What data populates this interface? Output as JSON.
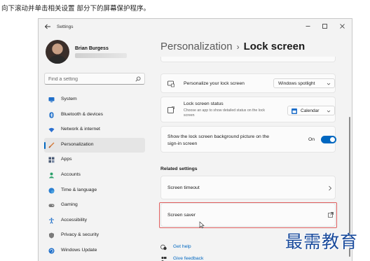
{
  "instruction": "向下滚动并单击相关设置 部分下的屏幕保护程序。",
  "window": {
    "title": "Settings",
    "controls": {
      "minimize": "minimize-icon",
      "maximize": "maximize-icon",
      "close": "close-icon"
    }
  },
  "profile": {
    "name": "Brian Burgess"
  },
  "search": {
    "placeholder": "Find a setting"
  },
  "sidebar": {
    "items": [
      {
        "label": "System",
        "icon": "monitor-icon",
        "color": "#1f6fc9"
      },
      {
        "label": "Bluetooth & devices",
        "icon": "bluetooth-icon",
        "color": "#1f6fc9"
      },
      {
        "label": "Network & internet",
        "icon": "wifi-icon",
        "color": "#2a6fd0"
      },
      {
        "label": "Personalization",
        "icon": "brush-icon",
        "color": "#d67b3a",
        "active": true
      },
      {
        "label": "Apps",
        "icon": "apps-icon",
        "color": "#4a5a74"
      },
      {
        "label": "Accounts",
        "icon": "person-icon",
        "color": "#2aa06a"
      },
      {
        "label": "Time & language",
        "icon": "globe-clock-icon",
        "color": "#2a7fd0"
      },
      {
        "label": "Gaming",
        "icon": "gamepad-icon",
        "color": "#7a7a7a"
      },
      {
        "label": "Accessibility",
        "icon": "accessibility-icon",
        "color": "#1f6fc9"
      },
      {
        "label": "Privacy & security",
        "icon": "shield-icon",
        "color": "#7a7a7a"
      },
      {
        "label": "Windows Update",
        "icon": "update-icon",
        "color": "#1f6fc9"
      }
    ]
  },
  "header": {
    "parent": "Personalization",
    "separator": "›",
    "current": "Lock screen"
  },
  "settings": {
    "personalize": {
      "title": "Personalize your lock screen",
      "value": "Windows spotlight"
    },
    "status": {
      "title": "Lock screen status",
      "subtitle": "Choose an app to show detailed status on the lock screen",
      "value": "Calendar"
    },
    "background": {
      "title": "Show the lock screen background picture on the sign-in screen",
      "toggle_label": "On",
      "toggle_on": true
    }
  },
  "related": {
    "heading": "Related settings",
    "screen_timeout": "Screen timeout",
    "screen_saver": "Screen saver"
  },
  "links": {
    "get_help": "Get help",
    "give_feedback": "Give feedback"
  },
  "watermark": "最需教育",
  "colors": {
    "accent": "#0067c0",
    "highlight": "#e06060"
  }
}
